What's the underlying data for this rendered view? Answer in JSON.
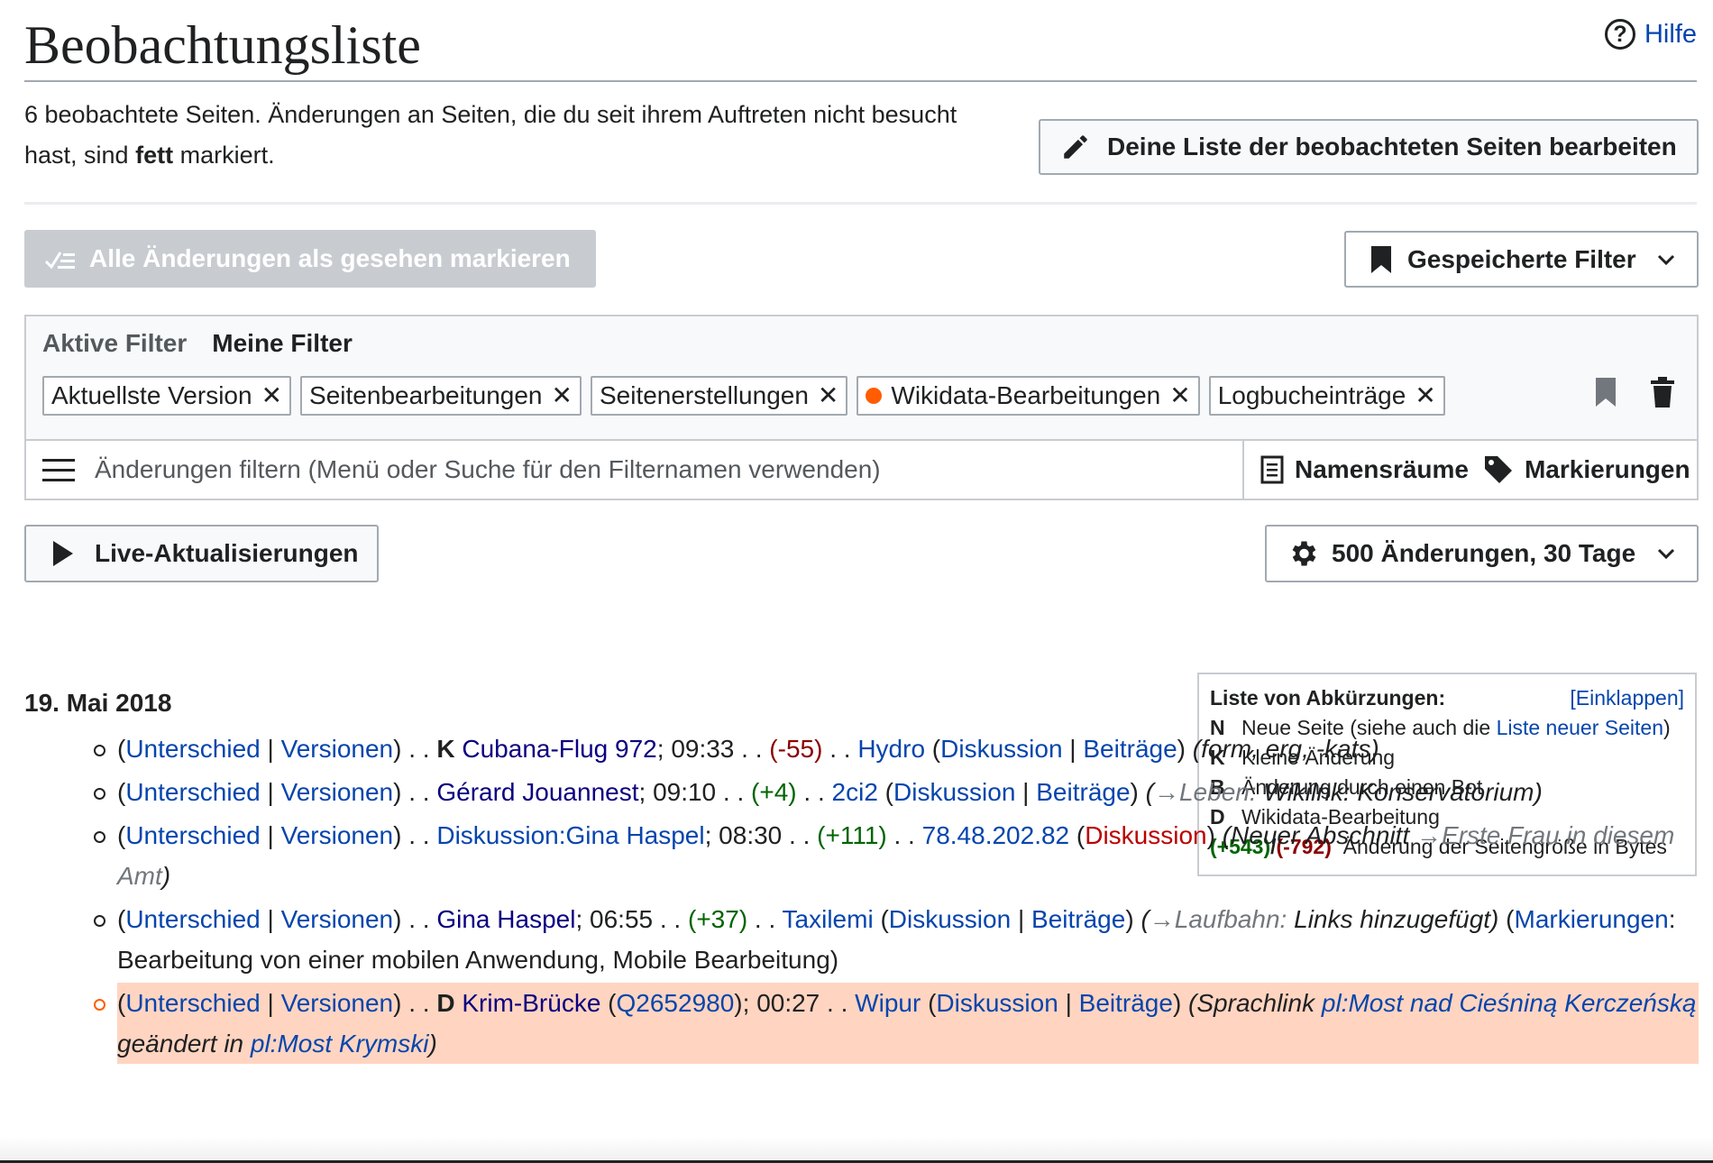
{
  "header": {
    "title": "Beobachtungsliste",
    "help_label": "Hilfe",
    "help_icon": "?"
  },
  "intro": {
    "text_before": "6 beobachtete Seiten. Änderungen an Seiten, die du seit ihrem Auftreten nicht besucht hast, sind ",
    "bold": "fett",
    "text_after": " markiert."
  },
  "buttons": {
    "edit_list": "Deine Liste der beobachteten Seiten bearbeiten",
    "mark_all_seen": "Alle Änderungen als gesehen markieren",
    "saved_filters": "Gespeicherte Filter",
    "live_updates": "Live-Aktualisierungen",
    "settings": "500 Änderungen, 30 Tage"
  },
  "filters": {
    "tab_active": "Aktive Filter",
    "tab_mine": "Meine Filter",
    "chips": [
      {
        "label": "Aktuellste Version"
      },
      {
        "label": "Seitenbearbeitungen"
      },
      {
        "label": "Seitenerstellungen"
      },
      {
        "label": "Wikidata-Bearbeitungen"
      },
      {
        "label": "Logbucheinträge"
      }
    ],
    "chip_dot_color": "#ff5d00",
    "search_placeholder": "Änderungen filtern (Menü oder Suche für den Filternamen verwenden)",
    "namespaces": "Namensräume",
    "tags": "Markierungen"
  },
  "legend": {
    "title": "Liste von Abkürzungen:",
    "collapse": "[Einklappen]",
    "rows": [
      {
        "key": "N",
        "text": "Neue Seite (siehe auch die ",
        "link": "Liste neuer Seiten",
        "after": ")"
      },
      {
        "key": "K",
        "text": "Kleine Änderung"
      },
      {
        "key": "B",
        "text": "Änderung durch einen Bot"
      },
      {
        "key": "D",
        "text": "Wikidata-Bearbeitung"
      }
    ],
    "size_pos": "(+543)",
    "size_sep": "/",
    "size_neg": "(-792)",
    "size_text": "Änderung der Seitengröße in Bytes"
  },
  "changes": {
    "date": "19. Mai 2018",
    "diff": "Unterschied",
    "hist": "Versionen",
    "talk": "Diskussion",
    "contribs": "Beiträge",
    "items": [
      {
        "flag": "K",
        "page": "Cubana-Flug 972",
        "time": "09:33",
        "size": "(-55)",
        "size_sign": "neg",
        "user": "Hydro",
        "summary": "(form, erg, -kats)"
      },
      {
        "page": "Gérard Jouannest",
        "time": "09:10",
        "size": "(+4)",
        "size_sign": "pos",
        "user": "2ci2",
        "section": "Leben:",
        "summary_rest": " Wikilnk: Konservatorium)"
      },
      {
        "page": "Diskussion:Gina Haspel",
        "time": "08:30",
        "size": "(+111)",
        "size_sign": "pos",
        "user": "78.48.202.82",
        "summary_prefix": "(Neuer Abschnitt ",
        "section": "Erste Frau in diesem Amt",
        "summary_rest": ")"
      },
      {
        "page": "Gina Haspel",
        "time": "06:55",
        "size": "(+37)",
        "size_sign": "pos",
        "user": "Taxilemi",
        "section": "Laufbahn:",
        "summary_rest": " Links hinzugefügt)",
        "tags_label": "Markierungen",
        "tags_text": ": Bearbeitung von einer mobilen Anwendung, Mobile Bearbeitung)"
      },
      {
        "flag": "D",
        "page": "Krim-Brücke",
        "qid": "Q2652980",
        "time": "00:27",
        "user": "Wipur",
        "summary_prefix": "(Sprachlink ",
        "link1": "pl:Most nad Cieśniną Kerczeńską",
        "summary_mid": " geändert in ",
        "link2": "pl:Most Krymski",
        "summary_rest": ")"
      }
    ]
  }
}
